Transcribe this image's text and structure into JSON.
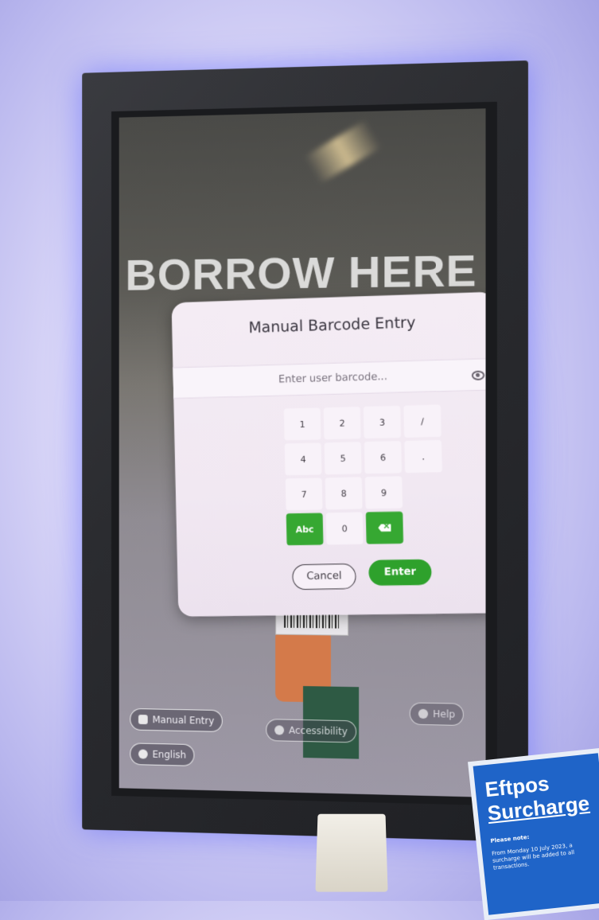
{
  "kiosk": {
    "headline": "BORROW HERE"
  },
  "dialog": {
    "title": "Manual Barcode Entry",
    "input_placeholder": "Enter user barcode...",
    "keys": [
      "1",
      "2",
      "3",
      "/",
      "4",
      "5",
      "6",
      ".",
      "7",
      "8",
      "9",
      "",
      "Abc",
      "0",
      "⌫",
      ""
    ],
    "cancel_label": "Cancel",
    "enter_label": "Enter"
  },
  "bottom_bar": {
    "manual_entry_label": "Manual Entry",
    "accessibility_label": "Accessibility",
    "help_label": "Help",
    "language_label": "English"
  },
  "sign": {
    "title_line1": "Eftpos",
    "title_line2": "Surcharge",
    "note_label": "Please note:",
    "body_text": "From Monday 10 July 2023, a surcharge will be added to all transactions."
  },
  "colors": {
    "accent_green": "#36a832",
    "sign_blue": "#1f64c8"
  }
}
